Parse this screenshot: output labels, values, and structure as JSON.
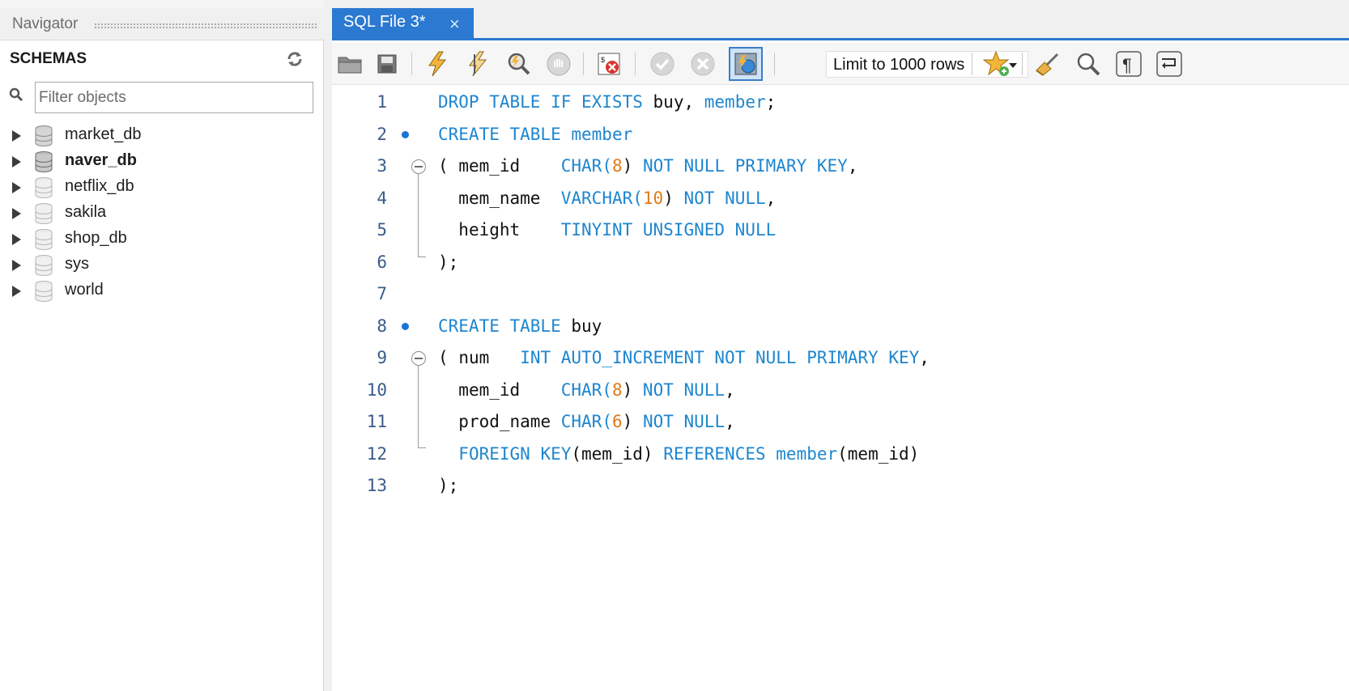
{
  "navigator": {
    "title": "Navigator",
    "schemas_label": "SCHEMAS",
    "filter_placeholder": "Filter objects",
    "schemas": [
      {
        "name": "market_db",
        "bold": false
      },
      {
        "name": "naver_db",
        "bold": true
      },
      {
        "name": "netflix_db",
        "bold": false
      },
      {
        "name": "sakila",
        "bold": false
      },
      {
        "name": "shop_db",
        "bold": false
      },
      {
        "name": "sys",
        "bold": false
      },
      {
        "name": "world",
        "bold": false
      }
    ]
  },
  "editor": {
    "tab_label": "SQL File 3*",
    "tab_close": "×",
    "limit_label": "Limit to 1000 rows",
    "lines": [
      {
        "n": "1"
      },
      {
        "n": "2"
      },
      {
        "n": "3"
      },
      {
        "n": "4"
      },
      {
        "n": "5"
      },
      {
        "n": "6"
      },
      {
        "n": "7"
      },
      {
        "n": "8"
      },
      {
        "n": "9"
      },
      {
        "n": "10"
      },
      {
        "n": "11"
      },
      {
        "n": "12"
      },
      {
        "n": "13"
      }
    ],
    "code": {
      "l1": [
        "DROP TABLE IF EXISTS",
        "buy,",
        "member",
        ";"
      ],
      "l2": [
        "CREATE TABLE",
        "member"
      ],
      "l3": [
        "(",
        "mem_id",
        "CHAR(",
        "8",
        ")",
        "NOT NULL PRIMARY KEY",
        ","
      ],
      "l4": [
        "mem_name",
        "VARCHAR(",
        "10",
        ")",
        "NOT NULL",
        ","
      ],
      "l5": [
        "height",
        "TINYINT UNSIGNED NULL"
      ],
      "l6": [
        ");"
      ],
      "l8": [
        "CREATE TABLE",
        "buy"
      ],
      "l9": [
        "(",
        "num",
        "INT AUTO_INCREMENT NOT NULL PRIMARY KEY",
        ","
      ],
      "l10": [
        "mem_id",
        "CHAR(",
        "8",
        ")",
        "NOT NULL",
        ","
      ],
      "l11": [
        "prod_name",
        "CHAR(",
        "6",
        ")",
        "NOT NULL",
        ","
      ],
      "l12": [
        "FOREIGN KEY",
        "(mem_id)",
        "REFERENCES",
        "member",
        "(mem_id)"
      ],
      "l13": [
        ");"
      ]
    }
  },
  "colors": {
    "accent": "#2b79d1",
    "keyword": "#1e86cf",
    "number": "#e07b1a",
    "marker": "#1a73d6"
  },
  "icons": [
    "open-file-icon",
    "save-icon",
    "execute-icon",
    "execute-current-icon",
    "explain-icon",
    "stop-icon",
    "toggle-error-icon",
    "commit-icon",
    "rollback-icon",
    "autocommit-icon",
    "add-snippet-icon",
    "beautify-icon",
    "find-icon",
    "invisible-chars-icon",
    "word-wrap-icon",
    "refresh-icon",
    "search-icon",
    "database-icon"
  ]
}
